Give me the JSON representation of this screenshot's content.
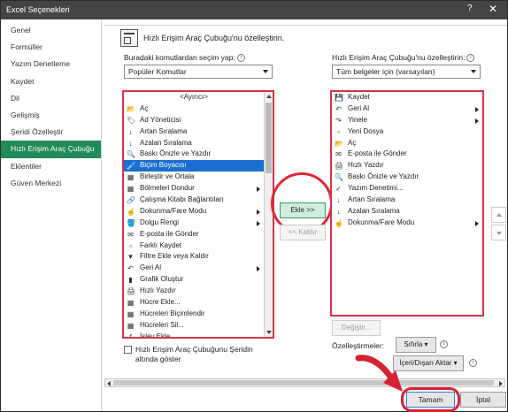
{
  "window": {
    "title": "Excel Seçenekleri",
    "help": "?",
    "close": "✕"
  },
  "sidebar": {
    "items": [
      {
        "label": "Genel"
      },
      {
        "label": "Formüller"
      },
      {
        "label": "Yazım Denetleme"
      },
      {
        "label": "Kaydet"
      },
      {
        "label": "Dil"
      },
      {
        "label": "Gelişmiş"
      },
      {
        "label": "Şeridi Özelleştir"
      },
      {
        "label": "Hızlı Erişim Araç Çubuğu",
        "selected": true
      },
      {
        "label": "Eklentiler"
      },
      {
        "label": "Güven Merkezi"
      }
    ]
  },
  "main": {
    "header": "Hızlı Erişim Araç Çubuğu'nu özelleştirin.",
    "choose_label": "Buradaki komutlardan seçim yap:",
    "choose_value": "Popüler Komutlar",
    "customize_label": "Hızlı Erişim Araç Çubuğu'nu özelleştirin:",
    "customize_value": "Tüm belgeler için (varsayılan)",
    "left_list": [
      {
        "label": "<Ayırıcı>",
        "icon": ""
      },
      {
        "label": "Aç",
        "icon": "📂"
      },
      {
        "label": "Ad Yöneticisi",
        "icon": "🏷"
      },
      {
        "label": "Artan Sıralama",
        "icon": "↓"
      },
      {
        "label": "Azalan Sıralama",
        "icon": "↓"
      },
      {
        "label": "Baskı Önizle ve Yazdır",
        "icon": "🔍"
      },
      {
        "label": "Biçim Boyacısı",
        "icon": "🖌",
        "selected": true
      },
      {
        "label": "Birleştir ve Ortala",
        "icon": "▦"
      },
      {
        "label": "Bölmeleri Dondur",
        "icon": "▦",
        "submenu": true
      },
      {
        "label": "Çalışma Kitabı Bağlantıları",
        "icon": "🔗"
      },
      {
        "label": "Dokunma/Fare Modu",
        "icon": "☝",
        "submenu": true
      },
      {
        "label": "Dolgu Rengi",
        "icon": "🪣",
        "submenu": true
      },
      {
        "label": "E-posta ile Gönder",
        "icon": "✉"
      },
      {
        "label": "Farklı Kaydet",
        "icon": "▫"
      },
      {
        "label": "Filtre Ekle veya Kaldır",
        "icon": "▼"
      },
      {
        "label": "Geri Al",
        "icon": "↶",
        "submenu": true
      },
      {
        "label": "Grafik Oluştur",
        "icon": "▮"
      },
      {
        "label": "Hızlı Yazdır",
        "icon": "🖨"
      },
      {
        "label": "Hücre Ekle...",
        "icon": "▦"
      },
      {
        "label": "Hücreleri Biçimlendir",
        "icon": "▦"
      },
      {
        "label": "Hücreleri Sil...",
        "icon": "▦"
      },
      {
        "label": "İşlev Ekle...",
        "icon": "ƒ"
      }
    ],
    "right_list": [
      {
        "label": "Kaydet",
        "icon": "💾"
      },
      {
        "label": "Geri Al",
        "icon": "↶",
        "submenu": true
      },
      {
        "label": "Yinele",
        "icon": "↷",
        "submenu": true
      },
      {
        "label": "Yeni Dosya",
        "icon": "▫"
      },
      {
        "label": "Aç",
        "icon": "📂"
      },
      {
        "label": "E-posta ile Gönder",
        "icon": "✉"
      },
      {
        "label": "Hızlı Yazdır",
        "icon": "🖨"
      },
      {
        "label": "Baskı Önizle ve Yazdır",
        "icon": "🔍"
      },
      {
        "label": "Yazım Denetimi...",
        "icon": "✓"
      },
      {
        "label": "Artan Sıralama",
        "icon": "↓"
      },
      {
        "label": "Azalan Sıralama",
        "icon": "↓"
      },
      {
        "label": "Dokunma/Fare Modu",
        "icon": "☝",
        "submenu": true
      }
    ],
    "add_button": "Ekle >>",
    "remove_button": "<< Kaldır",
    "modify_button": "Değiştir...",
    "customizations_label": "Özelleştirmeler:",
    "reset_button": "Sıfırla",
    "import_export_button": "İçeri/Dışarı Aktar",
    "show_below_label": "Hızlı Erişim Araç Çubuğunu Şeridin altında göster",
    "show_below_checked": false
  },
  "footer": {
    "ok": "Tamam",
    "cancel": "İptal"
  },
  "colors": {
    "accent": "#218b59",
    "highlight": "#d9334b",
    "selection": "#1a6fd0"
  }
}
